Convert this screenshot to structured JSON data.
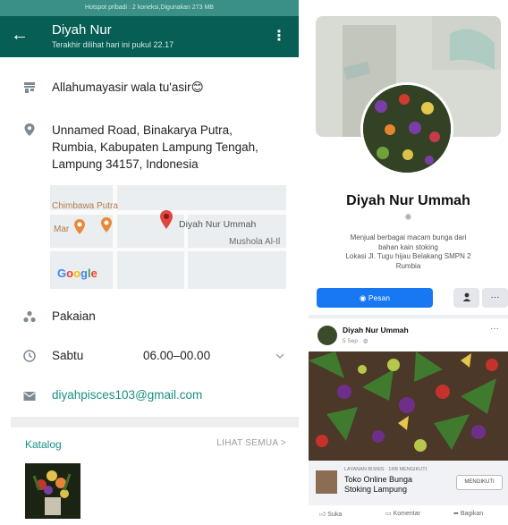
{
  "whatsapp": {
    "status_bar": "Hotspot pribadi : 2 koneksi,Digunakan 273 MB",
    "header": {
      "back_icon": "arrow-left-icon",
      "name": "Diyah Nur",
      "subtitle": "Terakhir dilihat hari ini pukul 22.17",
      "menu_icon": "more-vertical-icon"
    },
    "description": "Allahumayasir wala tu'asir",
    "description_emoji": "😊",
    "address_lines": [
      "Unnamed Road, Binakarya Putra,",
      "Rumbia, Kabupaten Lampung Tengah,",
      "Lampung 34157, Indonesia"
    ],
    "map": {
      "labels": [
        "Chimbawa Putra",
        "Mar",
        "Diyah Nur Ummah",
        "Mushola Al-Il"
      ],
      "google_letters": [
        "G",
        "o",
        "o",
        "g",
        "l",
        "e"
      ]
    },
    "category": "Pakaian",
    "hours": {
      "day": "Sabtu",
      "time": "06.00–00.00"
    },
    "email": "diyahpisces103@gmail.com",
    "catalog": {
      "title": "Katalog",
      "see_all": "LIHAT SEMUA >"
    },
    "colors": {
      "header": "#075e54",
      "accent": "#1b8f85"
    }
  },
  "facebook": {
    "page_name": "Diyah Nur Ummah",
    "description": [
      "Menjual berbagai macam bunga dari",
      "bahan kain stoking",
      "Lokasi Jl. Tugu hijau Belakang SMPN 2",
      "Rumbia"
    ],
    "buttons": {
      "message": "Pesan",
      "profile_icon": "person-icon",
      "more": "···"
    },
    "post": {
      "author": "Diyah Nur Ummah",
      "date": "5 Sep · ",
      "more": "···"
    },
    "ad": {
      "kicker": "LAYANAN BISNIS · 1RB MENGIKUTI",
      "title_lines": [
        "Toko Online Bunga",
        "Stoking Lampung"
      ],
      "follow": "MENGIKUTI"
    },
    "actions": {
      "like": "Suka",
      "comment": "Komentar",
      "share": "Bagikan"
    },
    "colors": {
      "primary": "#1877f2"
    }
  }
}
